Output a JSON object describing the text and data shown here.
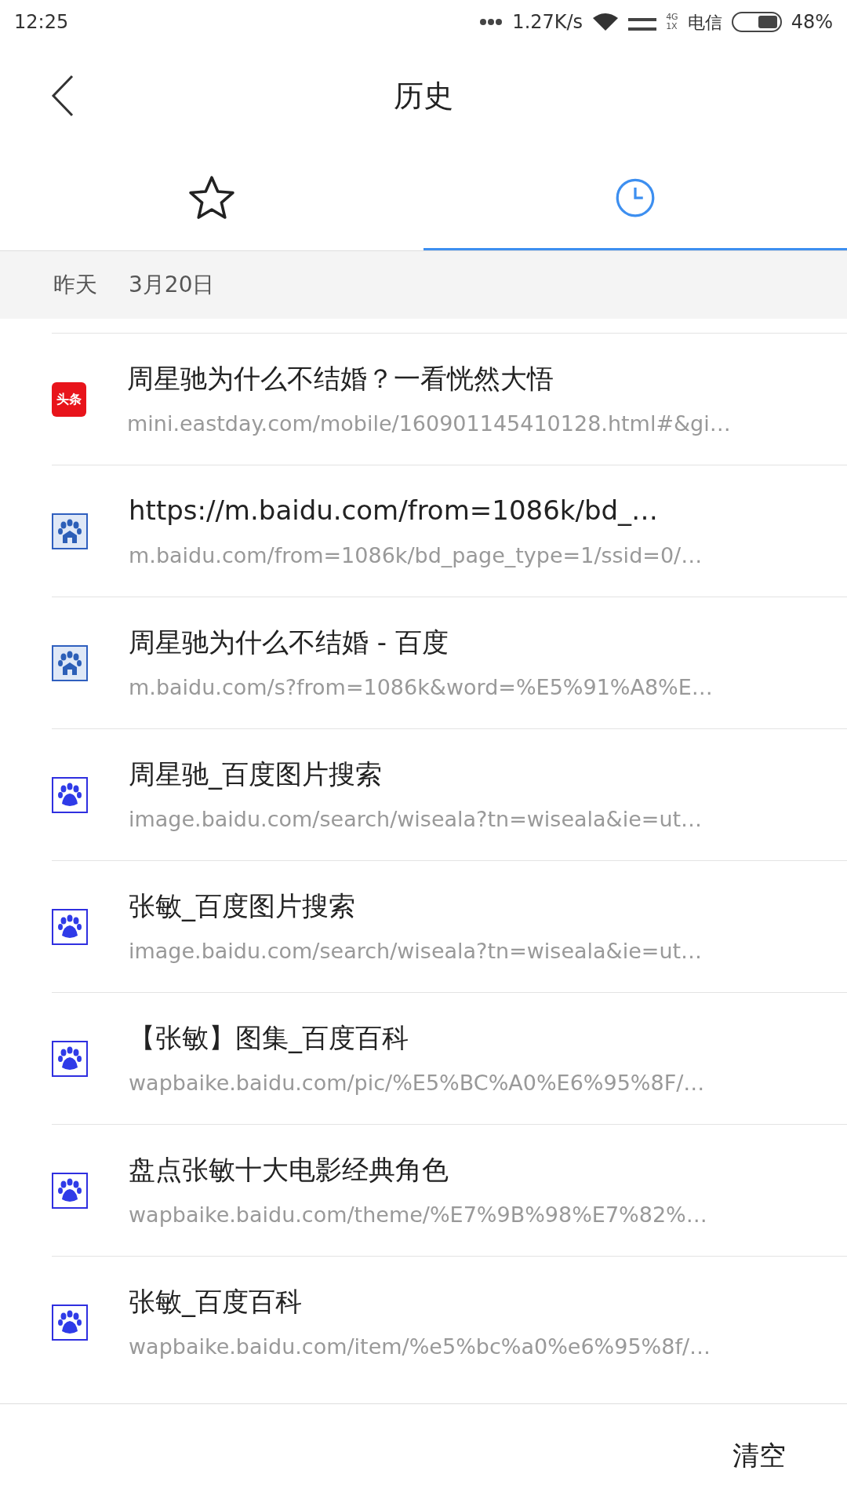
{
  "status_bar": {
    "time": "12:25",
    "speed": "1.27K/s",
    "network_top": "4G",
    "network_bottom": "1X",
    "carrier": "电信",
    "battery": "48%"
  },
  "header": {
    "title": "历史"
  },
  "tabs": [
    {
      "kind": "star",
      "selected": false
    },
    {
      "kind": "clock",
      "selected": true
    }
  ],
  "date_header": {
    "day": "昨天",
    "date": "3月20日"
  },
  "history": [
    {
      "kind": "toutiao",
      "icon_text": "头条",
      "title": "周星驰为什么不结婚？一看恍然大悟",
      "url": "mini.eastday.com/mobile/160901145410128.html#&gi…"
    },
    {
      "kind": "baidu_old",
      "title": "https://m.baidu.com/from=1086k/bd_…",
      "url": "m.baidu.com/from=1086k/bd_page_type=1/ssid=0/…"
    },
    {
      "kind": "baidu_old",
      "title": "周星驰为什么不结婚 - 百度",
      "url": "m.baidu.com/s?from=1086k&word=%E5%91%A8%E…"
    },
    {
      "kind": "baidu",
      "title": "周星驰_百度图片搜索",
      "url": "image.baidu.com/search/wiseala?tn=wiseala&ie=ut…"
    },
    {
      "kind": "baidu",
      "title": "张敏_百度图片搜索",
      "url": "image.baidu.com/search/wiseala?tn=wiseala&ie=ut…"
    },
    {
      "kind": "baidu",
      "title": "【张敏】图集_百度百科",
      "url": "wapbaike.baidu.com/pic/%E5%BC%A0%E6%95%8F/…"
    },
    {
      "kind": "baidu",
      "title": "盘点张敏十大电影经典角色",
      "url": "wapbaike.baidu.com/theme/%E7%9B%98%E7%82%…"
    },
    {
      "kind": "baidu",
      "title": "张敏_百度百科",
      "url": "wapbaike.baidu.com/item/%e5%bc%a0%e6%95%8f/…"
    }
  ],
  "footer": {
    "clear_button": "清空"
  }
}
